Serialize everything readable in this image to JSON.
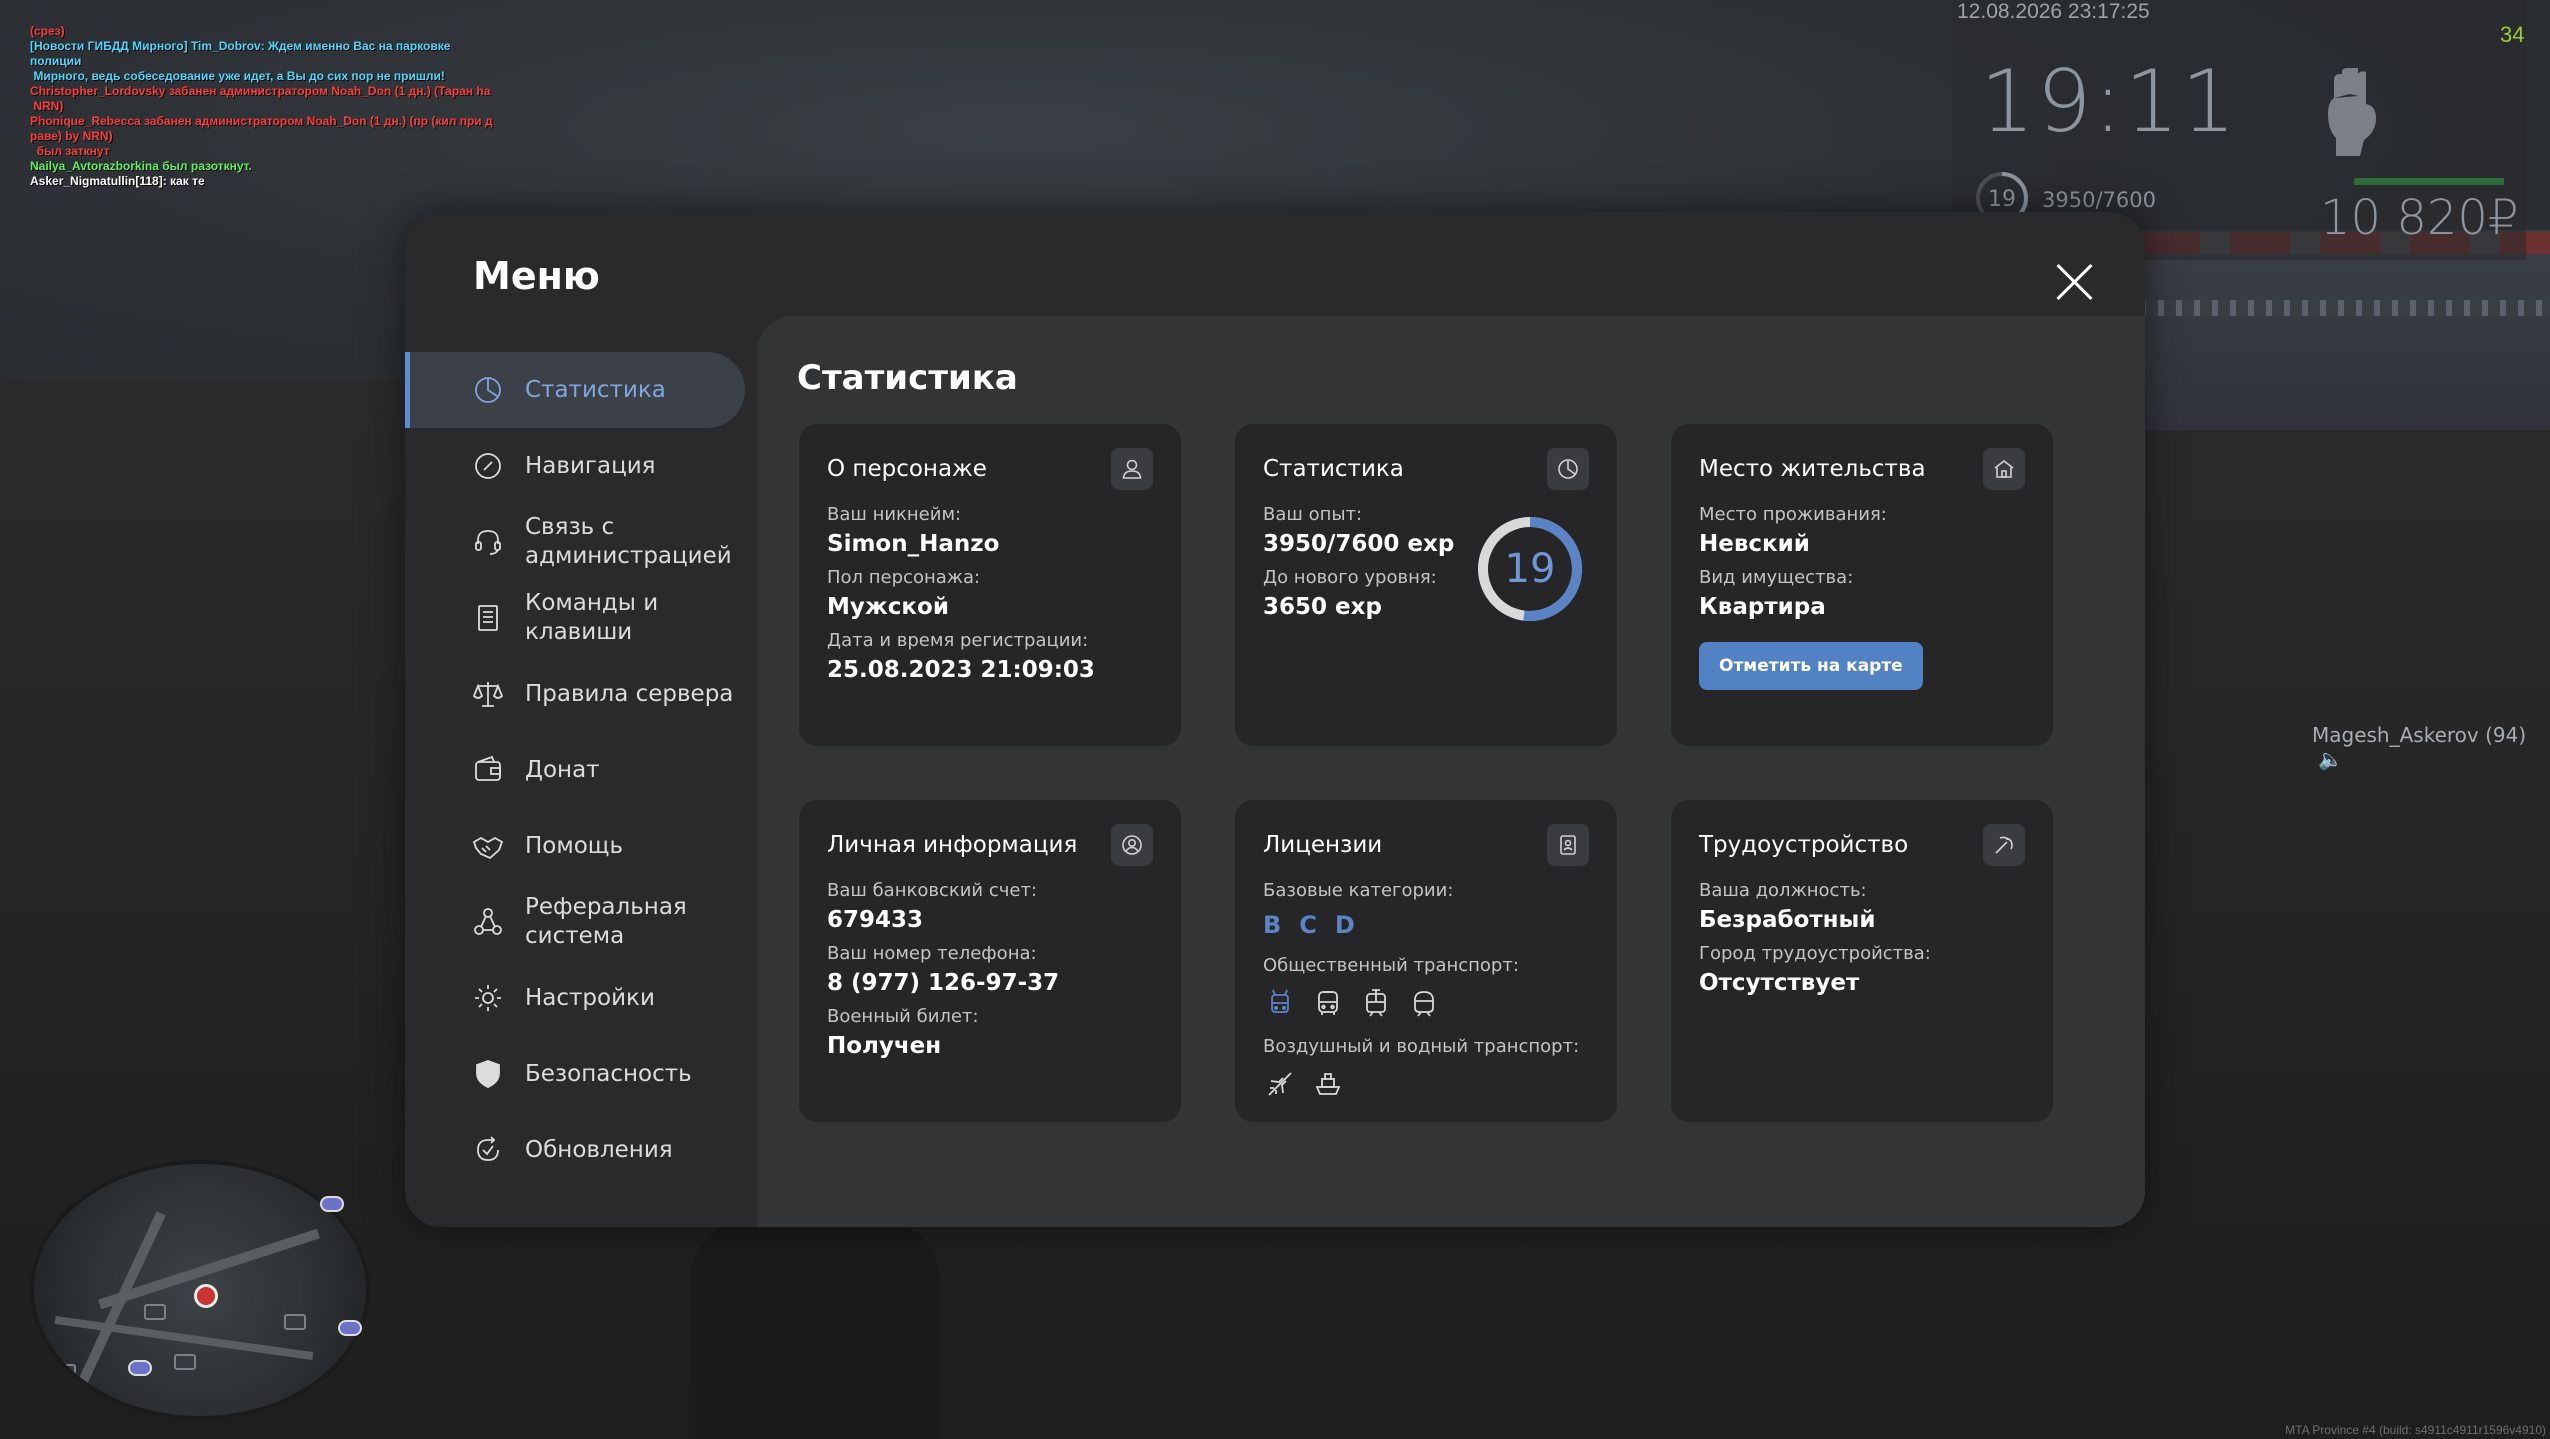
{
  "chat": [
    {
      "text": "(срез)",
      "color": "#ff3b3b"
    },
    {
      "text": "[Новости ГИБДД Мирного] Tim_Dobrov: Ждем именно Вас на парковке полиции\n Мирного, ведь собеседование уже идет, а Вы до сих пор не пришли!",
      "color": "#4fd8ff"
    },
    {
      "text": "Christopher_Lordovsky забанен администратором Noah_Don (1 дн.) (Таран ha\n NRN)",
      "color": "#ff3b3b"
    },
    {
      "text": "Phonique_Rebecca забанен администратором Noah_Don (1 дн.) (пр (кил при д\nраве) by NRN)\n  был заткнут",
      "color": "#ff3b3b"
    },
    {
      "text": "Nailya_Avtorazborkina был разоткнут.",
      "color": "#5ef25e"
    },
    {
      "text": "Asker_Nigmatullin[118]: как те",
      "color": "#ffffff"
    }
  ],
  "hud": {
    "datetime": "12.08.2026 23:17:25",
    "fps": "34",
    "clock": "19:11",
    "level": "19",
    "exp": "3950/7600",
    "money": "10 820₽",
    "colors": {
      "accent": "#5d8ad0",
      "fps": "#9ccc3c",
      "money_bar": "#2f6a3a"
    }
  },
  "player_tag": "Magesh_Askerov (94)",
  "build_info": "MTA Province #4 (build: s4911c4911r1596v4910)",
  "menu": {
    "title": "Меню",
    "close_icon": "close-icon",
    "nav": [
      {
        "label": "Статистика",
        "icon": "pie-chart-icon",
        "active": true
      },
      {
        "label": "Навигация",
        "icon": "compass-icon",
        "active": false
      },
      {
        "label": "Связь с\nадминистрацией",
        "icon": "headset-icon",
        "active": false
      },
      {
        "label": "Команды и\nклавиши",
        "icon": "keyboard-list-icon",
        "active": false
      },
      {
        "label": "Правила сервера",
        "icon": "scales-icon",
        "active": false
      },
      {
        "label": "Донат",
        "icon": "wallet-icon",
        "active": false
      },
      {
        "label": "Помощь",
        "icon": "handshake-icon",
        "active": false
      },
      {
        "label": "Реферальная\nсистема",
        "icon": "network-icon",
        "active": false
      },
      {
        "label": "Настройки",
        "icon": "gear-icon",
        "active": false
      },
      {
        "label": "Безопасность",
        "icon": "shield-icon",
        "active": false
      },
      {
        "label": "Обновления",
        "icon": "refresh-icon",
        "active": false
      }
    ]
  },
  "content": {
    "title": "Статистика",
    "character": {
      "title": "О персонаже",
      "nickname_label": "Ваш никнейм:",
      "nickname": "Simon_Hanzo",
      "gender_label": "Пол персонажа:",
      "gender": "Мужской",
      "reg_label": "Дата и время регистрации:",
      "reg_date": "25.08.2023 21:09:03"
    },
    "stats": {
      "title": "Статистика",
      "exp_label": "Ваш опыт:",
      "exp": "3950/7600 exp",
      "next_label": "До нового уровня:",
      "next": "3650 exp",
      "level": "19",
      "progress": 0.52
    },
    "residence": {
      "title": "Место жительства",
      "place_label": "Место проживания:",
      "place": "Невский",
      "property_label": "Вид имущества:",
      "property": "Квартира",
      "button": "Отметить на карте"
    },
    "personal": {
      "title": "Личная информация",
      "bank_label": "Ваш банковский счет:",
      "bank": "679433",
      "phone_label": "Ваш номер телефона:",
      "phone": "8 (977) 126-97-37",
      "military_label": "Военный билет:",
      "military": "Получен"
    },
    "licenses": {
      "title": "Лицензии",
      "base_label": "Базовые категории:",
      "categories": [
        "B",
        "C",
        "D"
      ],
      "public_label": "Общественный транспорт:",
      "public_icons": [
        "trolleybus-icon",
        "bus-icon",
        "tram-icon",
        "metro-icon"
      ],
      "air_label": "Воздушный и водный транспорт:",
      "air_icons": [
        "plane-icon",
        "ship-icon"
      ]
    },
    "job": {
      "title": "Трудоустройство",
      "position_label": "Ваша должность:",
      "position": "Безработный",
      "city_label": "Город трудоустройства:",
      "city": "Отсутствует"
    }
  }
}
